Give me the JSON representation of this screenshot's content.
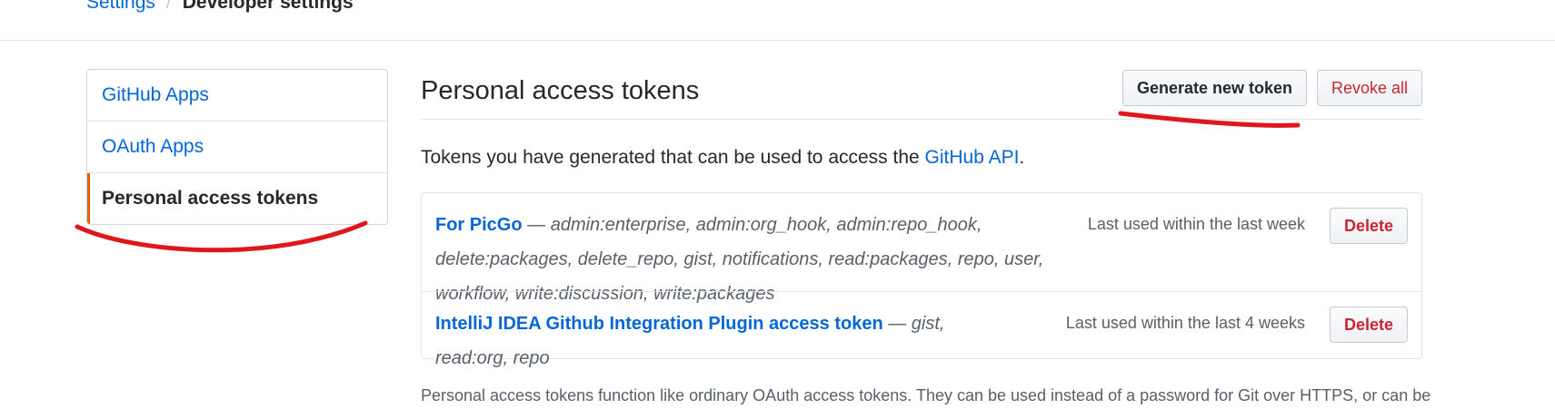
{
  "breadcrumb": {
    "parent": "Settings",
    "separator": "/",
    "current": "Developer settings"
  },
  "sidebar": {
    "items": [
      {
        "label": "GitHub Apps"
      },
      {
        "label": "OAuth Apps"
      },
      {
        "label": "Personal access tokens"
      }
    ],
    "selected": "Personal access tokens",
    "selected_accent": "#e36209"
  },
  "main": {
    "title": "Personal access tokens",
    "generate_label": "Generate new token",
    "revoke_label": "Revoke all",
    "intro_text": "Tokens you have generated that can be used to access the ",
    "intro_link": "GitHub API",
    "intro_end": ".",
    "footnote": "Personal access tokens function like ordinary OAuth access tokens. They can be used instead of a password for Git over HTTPS, or can be"
  },
  "tokens": [
    {
      "name": "For PicGo",
      "dash": " — ",
      "scopes": "admin:enterprise, admin:org_hook, admin:repo_hook, delete:packages, delete_repo, gist, notifications, read:packages, repo, user, workflow, write:discussion, write:packages",
      "last_used": "Last used within the last week",
      "delete_label": "Delete"
    },
    {
      "name": "IntelliJ IDEA Github Integration Plugin access token",
      "dash": " — ",
      "scopes": "gist, read:org, repo",
      "last_used": "Last used within the last 4 weeks",
      "delete_label": "Delete"
    }
  ],
  "colors": {
    "link": "#0366d6",
    "danger": "#cb2431",
    "annotation": "#e0161d"
  }
}
